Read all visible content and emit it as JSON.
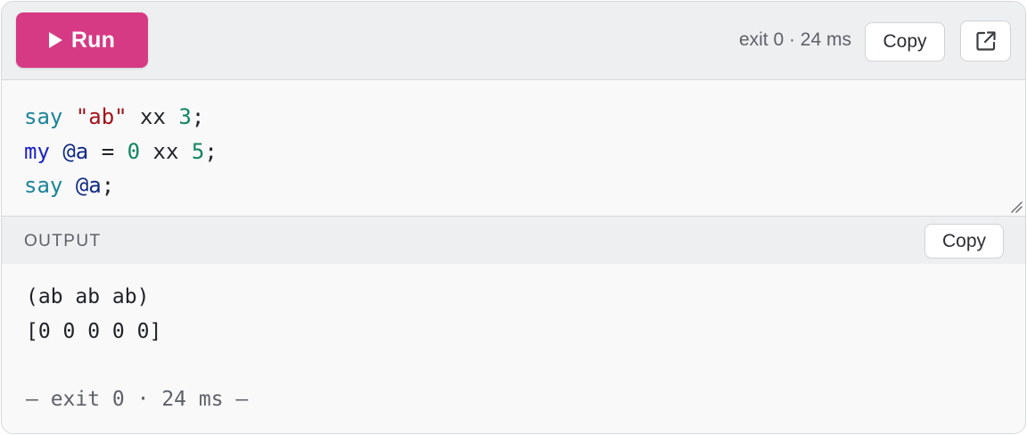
{
  "toolbar": {
    "run_label": "Run",
    "status": "exit 0 · 24 ms",
    "copy_label": "Copy"
  },
  "icons": {
    "run": "play-icon",
    "open": "external-link-icon",
    "resize": "resize-grip-icon"
  },
  "colors": {
    "run_button": "#d63a84",
    "keyword_fn": "#1b8497",
    "string": "#a3141a",
    "number": "#10855f",
    "keyword_decl": "#1a21c8",
    "variable": "#0f2a84"
  },
  "code": {
    "lines": [
      [
        {
          "t": "say",
          "k": "fn"
        },
        {
          "t": " ",
          "k": "plain"
        },
        {
          "t": "\"ab\"",
          "k": "str"
        },
        {
          "t": " xx ",
          "k": "plain"
        },
        {
          "t": "3",
          "k": "num"
        },
        {
          "t": ";",
          "k": "plain"
        }
      ],
      [
        {
          "t": "my",
          "k": "kw"
        },
        {
          "t": " ",
          "k": "plain"
        },
        {
          "t": "@a",
          "k": "var"
        },
        {
          "t": " = ",
          "k": "plain"
        },
        {
          "t": "0",
          "k": "num"
        },
        {
          "t": " xx ",
          "k": "plain"
        },
        {
          "t": "5",
          "k": "num"
        },
        {
          "t": ";",
          "k": "plain"
        }
      ],
      [
        {
          "t": "say",
          "k": "fn"
        },
        {
          "t": " ",
          "k": "plain"
        },
        {
          "t": "@a",
          "k": "var"
        },
        {
          "t": ";",
          "k": "plain"
        }
      ]
    ]
  },
  "output": {
    "label": "OUTPUT",
    "copy_label": "Copy",
    "lines": [
      "(ab ab ab)",
      "[0 0 0 0 0]"
    ],
    "footer": "— exit 0 · 24 ms —"
  }
}
